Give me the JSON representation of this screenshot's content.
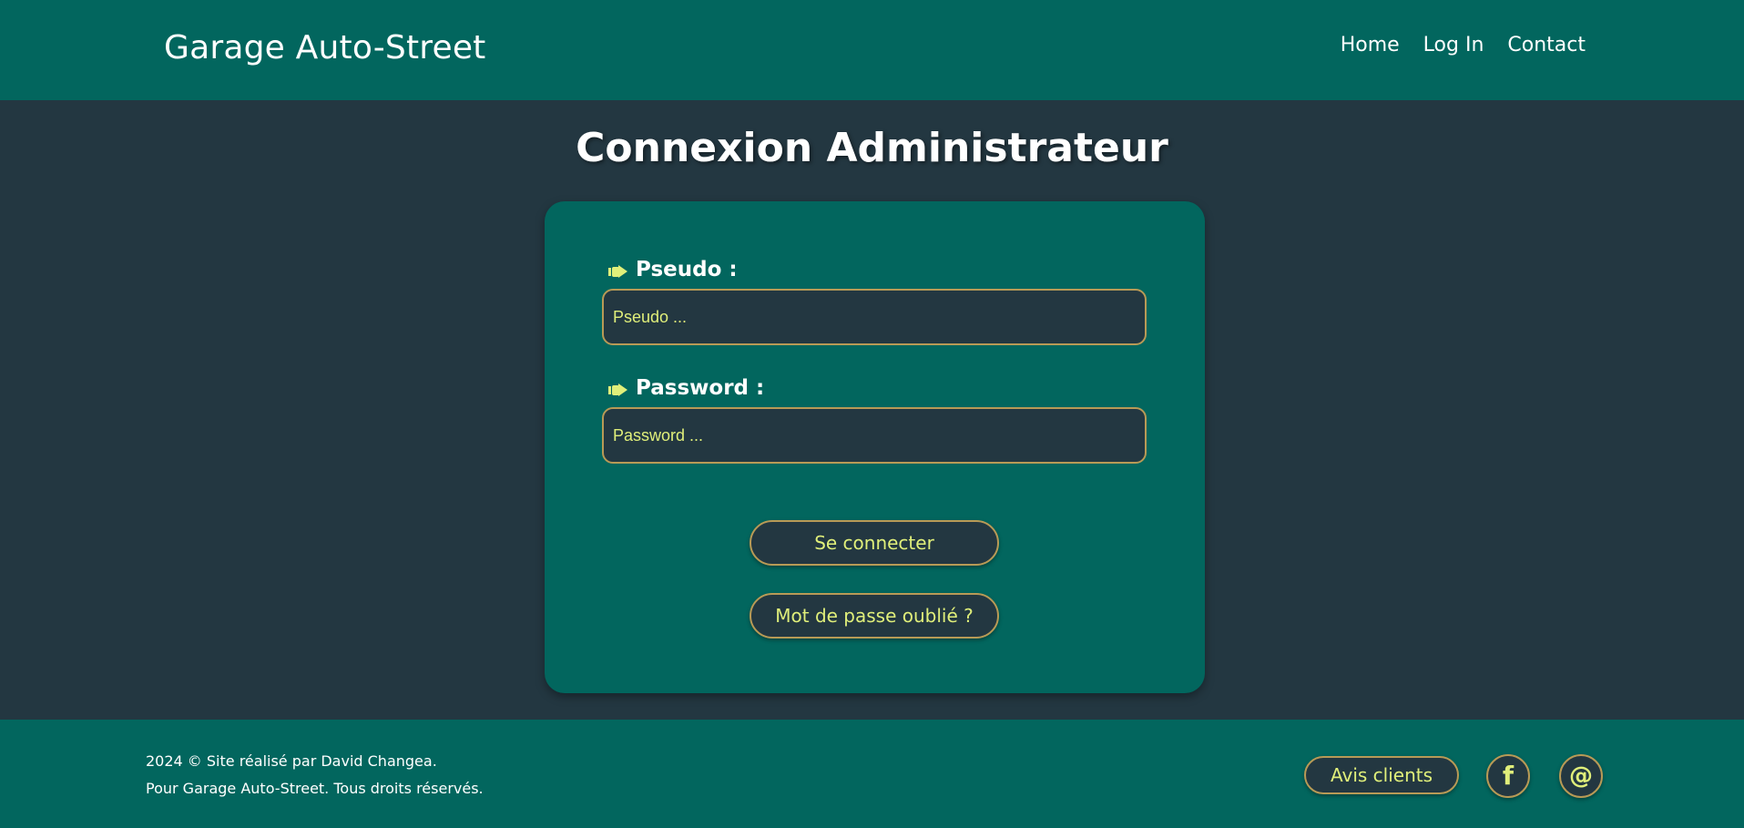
{
  "header": {
    "brand": "Garage Auto-Street",
    "nav": [
      {
        "label": "Home"
      },
      {
        "label": "Log In"
      },
      {
        "label": "Contact"
      }
    ]
  },
  "main": {
    "title": "Connexion Administrateur",
    "form": {
      "pseudo": {
        "label": "Pseudo :",
        "placeholder": "Pseudo ...",
        "icon": "hand-pointing-right-icon"
      },
      "password": {
        "label": "Password :",
        "placeholder": "Password ...",
        "icon": "hand-pointing-right-icon"
      },
      "submit_label": "Se connecter",
      "forgot_label": "Mot de passe oublié ?"
    }
  },
  "footer": {
    "line1": "2024 © Site réalisé par David Changea.",
    "line2": "Pour Garage Auto-Street. Tous droits réservés.",
    "reviews_label": "Avis clients",
    "social": [
      {
        "icon": "facebook-icon",
        "glyph": "f"
      },
      {
        "icon": "email-at-icon",
        "glyph": "@"
      }
    ]
  },
  "colors": {
    "primary": "#02665e",
    "background": "#233741",
    "accent_text": "#e0ef7a",
    "border": "#b89a56",
    "text": "#ffffff"
  }
}
